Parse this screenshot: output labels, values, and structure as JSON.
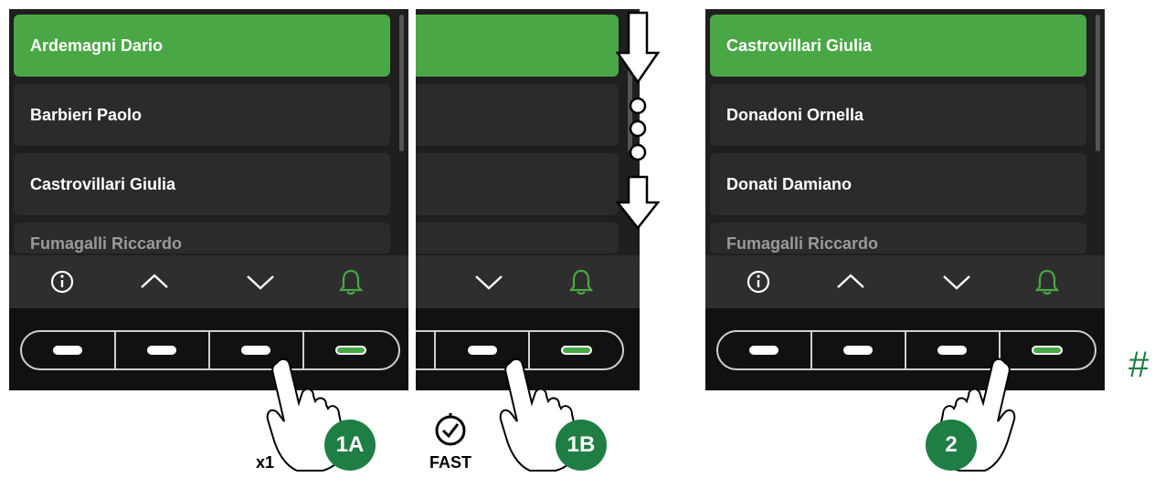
{
  "panel_a": {
    "items": [
      "Ardemagni Dario",
      "Barbieri Paolo",
      "Castrovillari Giulia",
      "Fumagalli Riccardo"
    ]
  },
  "panel_c": {
    "items": [
      "Castrovillari Giulia",
      "Donadoni Ornella",
      "Donati Damiano",
      "Fumagalli Riccardo"
    ]
  },
  "steps": {
    "step_1a": "1A",
    "step_1a_count": "x1",
    "step_1b": "1B",
    "step_1b_mode": "FAST",
    "step_2": "2",
    "confirm_symbol": "#"
  },
  "icons": [
    "info-icon",
    "chevron-up-icon",
    "chevron-down-icon",
    "bell-icon",
    "clock-icon",
    "arrow-down-icon",
    "hand-pointer-icon"
  ],
  "colors": {
    "selected": "#49a845",
    "badge": "#1f7e43",
    "panel": "#1f1f1f",
    "item": "#2b2b2b"
  }
}
